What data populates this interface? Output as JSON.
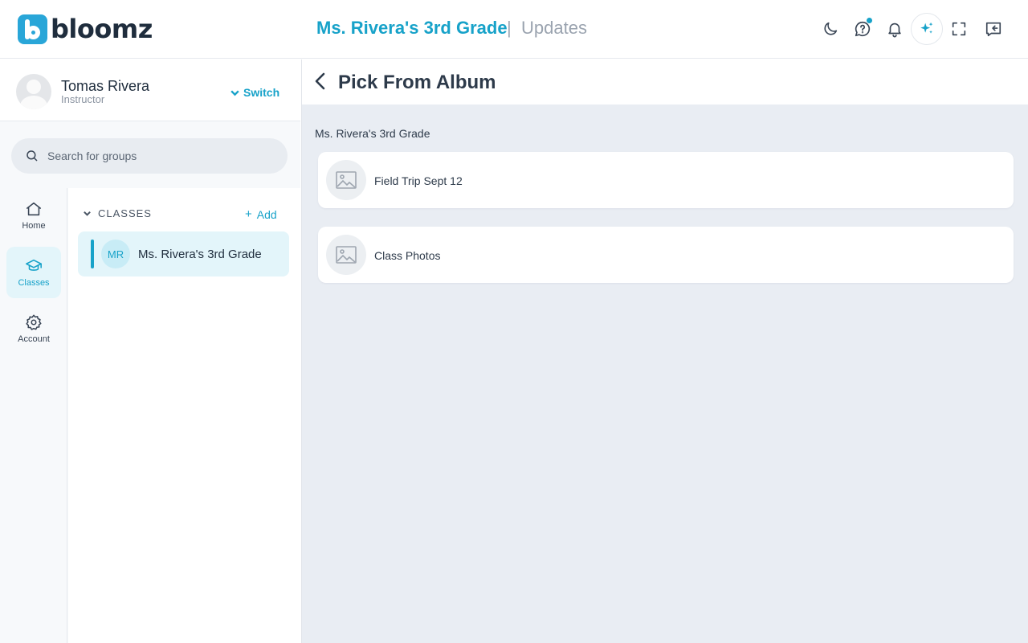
{
  "brand": {
    "name": "bloomz"
  },
  "header": {
    "group_title": "Ms. Rivera's 3rd Grade",
    "separator": "|",
    "section": "Updates",
    "icons": [
      "moon-icon",
      "help-chat-icon",
      "bell-icon",
      "ai-sparkle-icon",
      "fullscreen-icon",
      "collapse-panel-icon"
    ],
    "accent_color": "#17a2c9"
  },
  "profile": {
    "name": "Tomas Rivera",
    "role": "Instructor",
    "switch_label": "Switch"
  },
  "search": {
    "placeholder": "Search for groups"
  },
  "rail": {
    "items": [
      {
        "label": "Home",
        "icon": "home-icon",
        "active": false
      },
      {
        "label": "Classes",
        "icon": "graduation-cap-icon",
        "active": true
      },
      {
        "label": "Account",
        "icon": "gear-icon",
        "active": false
      }
    ]
  },
  "classes": {
    "heading": "CLASSES",
    "add_label": "Add",
    "items": [
      {
        "initials": "MR",
        "name": "Ms. Rivera's 3rd Grade",
        "selected": true
      }
    ]
  },
  "main": {
    "title": "Pick From Album",
    "group_label": "Ms. Rivera's 3rd Grade",
    "albums": [
      {
        "name": "Field Trip Sept 12"
      },
      {
        "name": "Class Photos"
      }
    ]
  }
}
